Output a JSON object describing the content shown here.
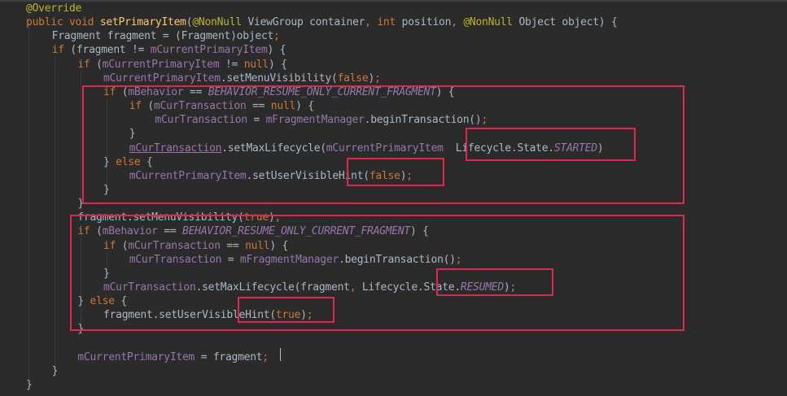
{
  "editor": {
    "theme_colors": {
      "background": "#2b2b2b",
      "keyword": "#cc7832",
      "annotation": "#bbb529",
      "method_declaration": "#ffc66d",
      "field": "#9876aa",
      "text": "#a9b7c6",
      "highlight_box": "#e0284f"
    },
    "lines": [
      {
        "indent": 0,
        "tokens": [
          [
            "ann",
            "@Override"
          ]
        ]
      },
      {
        "indent": 0,
        "tokens": [
          [
            "kw",
            "public void "
          ],
          [
            "mdecl",
            "setPrimaryItem"
          ],
          [
            "plain",
            "("
          ],
          [
            "ann",
            "@NonNull"
          ],
          [
            "plain",
            " ViewGroup container"
          ],
          [
            "punct",
            ", "
          ],
          [
            "kw",
            "int "
          ],
          [
            "plain",
            "position"
          ],
          [
            "punct",
            ", "
          ],
          [
            "ann",
            "@NonNull"
          ],
          [
            "plain",
            " Object object) {"
          ]
        ]
      },
      {
        "indent": 1,
        "tokens": [
          [
            "plain",
            "Fragment fragment = (Fragment)object"
          ],
          [
            "punct",
            ";"
          ]
        ]
      },
      {
        "indent": 1,
        "tokens": [
          [
            "kw",
            "if "
          ],
          [
            "plain",
            "(fragment != "
          ],
          [
            "field",
            "mCurrentPrimaryItem"
          ],
          [
            "plain",
            ") {"
          ]
        ]
      },
      {
        "indent": 2,
        "tokens": [
          [
            "kw",
            "if "
          ],
          [
            "plain",
            "("
          ],
          [
            "field",
            "mCurrentPrimaryItem"
          ],
          [
            "plain",
            " != "
          ],
          [
            "kw",
            "null"
          ],
          [
            "plain",
            ") {"
          ]
        ]
      },
      {
        "indent": 3,
        "tokens": [
          [
            "field",
            "mCurrentPrimaryItem"
          ],
          [
            "plain",
            ".setMenuVisibility("
          ],
          [
            "kw",
            "false"
          ],
          [
            "plain",
            ")"
          ],
          [
            "punct",
            ";"
          ]
        ]
      },
      {
        "indent": 3,
        "tokens": [
          [
            "kw",
            "if "
          ],
          [
            "plain",
            "("
          ],
          [
            "field",
            "mBehavior"
          ],
          [
            "plain",
            " == "
          ],
          [
            "const",
            "BEHAVIOR_RESUME_ONLY_CURRENT_FRAGMENT"
          ],
          [
            "plain",
            ") {"
          ]
        ]
      },
      {
        "indent": 4,
        "tokens": [
          [
            "kw",
            "if "
          ],
          [
            "plain",
            "("
          ],
          [
            "field",
            "mCurTransaction"
          ],
          [
            "plain",
            " == "
          ],
          [
            "kw",
            "null"
          ],
          [
            "plain",
            ") {"
          ]
        ]
      },
      {
        "indent": 5,
        "tokens": [
          [
            "field",
            "mCurTransaction"
          ],
          [
            "plain",
            " = "
          ],
          [
            "field",
            "mFragmentManager"
          ],
          [
            "plain",
            ".beginTransaction()"
          ],
          [
            "punct",
            ";"
          ]
        ]
      },
      {
        "indent": 4,
        "tokens": [
          [
            "plain",
            "}"
          ]
        ]
      },
      {
        "indent": 4,
        "tokens": [
          [
            "ulfield",
            "mCurTransaction"
          ],
          [
            "plain",
            ".setMaxLifecycle("
          ],
          [
            "field",
            "mCurrentPrimaryItem"
          ],
          [
            "plain",
            "  Lifecycle.State."
          ],
          [
            "const",
            "STARTED"
          ],
          [
            "plain",
            ")"
          ]
        ]
      },
      {
        "indent": 3,
        "tokens": [
          [
            "plain",
            "} "
          ],
          [
            "kw",
            "else "
          ],
          [
            "plain",
            "{"
          ]
        ]
      },
      {
        "indent": 4,
        "tokens": [
          [
            "field",
            "mCurrentPrimaryItem"
          ],
          [
            "plain",
            ".setUserVisibleHint("
          ],
          [
            "kw",
            "false"
          ],
          [
            "plain",
            ")"
          ],
          [
            "punct",
            ";"
          ]
        ]
      },
      {
        "indent": 3,
        "tokens": [
          [
            "plain",
            "}"
          ]
        ]
      },
      {
        "indent": 2,
        "tokens": [
          [
            "plain",
            "}"
          ]
        ]
      },
      {
        "indent": 2,
        "tokens": [
          [
            "plain",
            "fragment.setMenuVisibility("
          ],
          [
            "kw",
            "true"
          ],
          [
            "plain",
            ")"
          ],
          [
            "punct",
            ";"
          ]
        ]
      },
      {
        "indent": 2,
        "tokens": [
          [
            "kw",
            "if "
          ],
          [
            "plain",
            "("
          ],
          [
            "field",
            "mBehavior"
          ],
          [
            "plain",
            " == "
          ],
          [
            "const",
            "BEHAVIOR_RESUME_ONLY_CURRENT_FRAGMENT"
          ],
          [
            "plain",
            ") {"
          ]
        ]
      },
      {
        "indent": 3,
        "tokens": [
          [
            "kw",
            "if "
          ],
          [
            "plain",
            "("
          ],
          [
            "field",
            "mCurTransaction"
          ],
          [
            "plain",
            " == "
          ],
          [
            "kw",
            "null"
          ],
          [
            "plain",
            ") {"
          ]
        ]
      },
      {
        "indent": 4,
        "tokens": [
          [
            "field",
            "mCurTransaction"
          ],
          [
            "plain",
            " = "
          ],
          [
            "field",
            "mFragmentManager"
          ],
          [
            "plain",
            ".beginTransaction()"
          ],
          [
            "punct",
            ";"
          ]
        ]
      },
      {
        "indent": 3,
        "tokens": [
          [
            "plain",
            "}"
          ]
        ]
      },
      {
        "indent": 3,
        "tokens": [
          [
            "field",
            "mCurTransaction"
          ],
          [
            "plain",
            ".setMaxLifecycle(fragment"
          ],
          [
            "punct",
            ", "
          ],
          [
            "plain",
            "Lifecycle.State."
          ],
          [
            "const",
            "RESUMED"
          ],
          [
            "plain",
            ")"
          ],
          [
            "punct",
            ";"
          ]
        ]
      },
      {
        "indent": 2,
        "tokens": [
          [
            "plain",
            "} "
          ],
          [
            "kw",
            "else "
          ],
          [
            "plain",
            "{"
          ]
        ]
      },
      {
        "indent": 3,
        "tokens": [
          [
            "plain",
            "fragment.setUserVisibleHint("
          ],
          [
            "kw",
            "true"
          ],
          [
            "plain",
            ")"
          ],
          [
            "punct",
            ";"
          ]
        ]
      },
      {
        "indent": 2,
        "tokens": [
          [
            "plain",
            "}"
          ]
        ]
      },
      {
        "indent": 0,
        "tokens": []
      },
      {
        "indent": 2,
        "tokens": [
          [
            "field",
            "mCurrentPrimaryItem"
          ],
          [
            "plain",
            " = fragment"
          ],
          [
            "punct",
            ";"
          ]
        ]
      },
      {
        "indent": 1,
        "tokens": [
          [
            "plain",
            "}"
          ]
        ]
      },
      {
        "indent": 0,
        "tokens": [
          [
            "plain",
            "}"
          ]
        ]
      }
    ]
  }
}
